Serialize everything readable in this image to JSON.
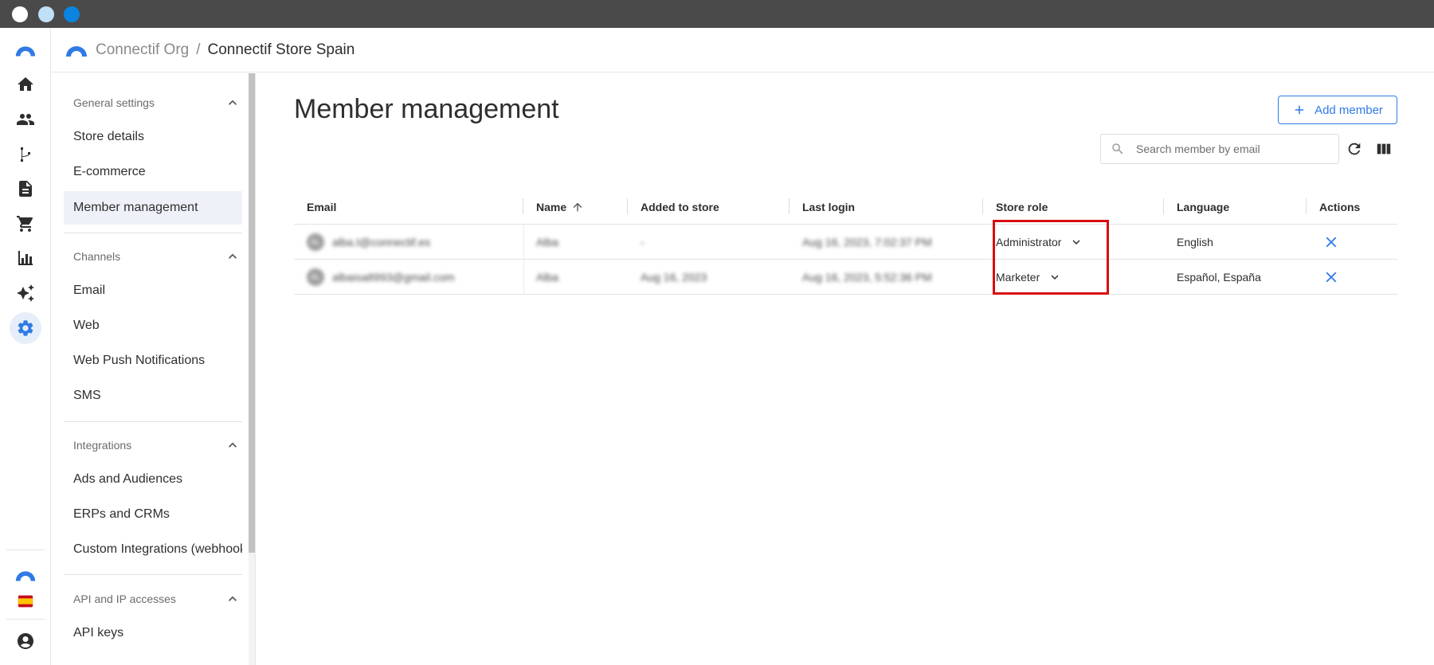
{
  "header": {
    "org": "Connectif Org",
    "separator": "/",
    "store": "Connectif Store Spain"
  },
  "rail": {
    "items": [
      "logo-icon",
      "home-icon",
      "people-icon",
      "workflow-icon",
      "content-icon",
      "cart-icon",
      "analytics-icon",
      "ai-sparkle-icon",
      "settings-icon"
    ],
    "bottom": [
      "connectif-logo-icon",
      "spain-flag-icon",
      "account-icon"
    ]
  },
  "sidebar": {
    "sections": [
      {
        "title": "General settings",
        "items": [
          "Store details",
          "E-commerce",
          "Member management"
        ]
      },
      {
        "title": "Channels",
        "items": [
          "Email",
          "Web",
          "Web Push Notifications",
          "SMS"
        ]
      },
      {
        "title": "Integrations",
        "items": [
          "Ads and Audiences",
          "ERPs and CRMs",
          "Custom Integrations (webhooks)"
        ]
      },
      {
        "title": "API and IP accesses",
        "items": [
          "API keys"
        ]
      }
    ],
    "active": "Member management"
  },
  "main": {
    "title": "Member management",
    "add_button": "Add member",
    "search_placeholder": "Search member by email"
  },
  "table": {
    "columns": [
      "Email",
      "Name",
      "Added to store",
      "Last login",
      "Store role",
      "Language",
      "Actions"
    ],
    "rows": [
      {
        "avatar": "AL",
        "email": "alba.t@connectif.es",
        "name": "Alba",
        "added": "-",
        "last_login": "Aug 16, 2023, 7:02:37 PM",
        "role": "Administrator",
        "language": "English"
      },
      {
        "avatar": "AL",
        "email": "albaisa8993@gmail.com",
        "name": "Alba",
        "added": "Aug 16, 2023",
        "last_login": "Aug 16, 2023, 5:52:36 PM",
        "role": "Marketer",
        "language": "Español, España"
      }
    ]
  },
  "colors": {
    "accent": "#2f7ae5",
    "highlight": "#d80d12",
    "titlebar": "#4a4a4a"
  }
}
